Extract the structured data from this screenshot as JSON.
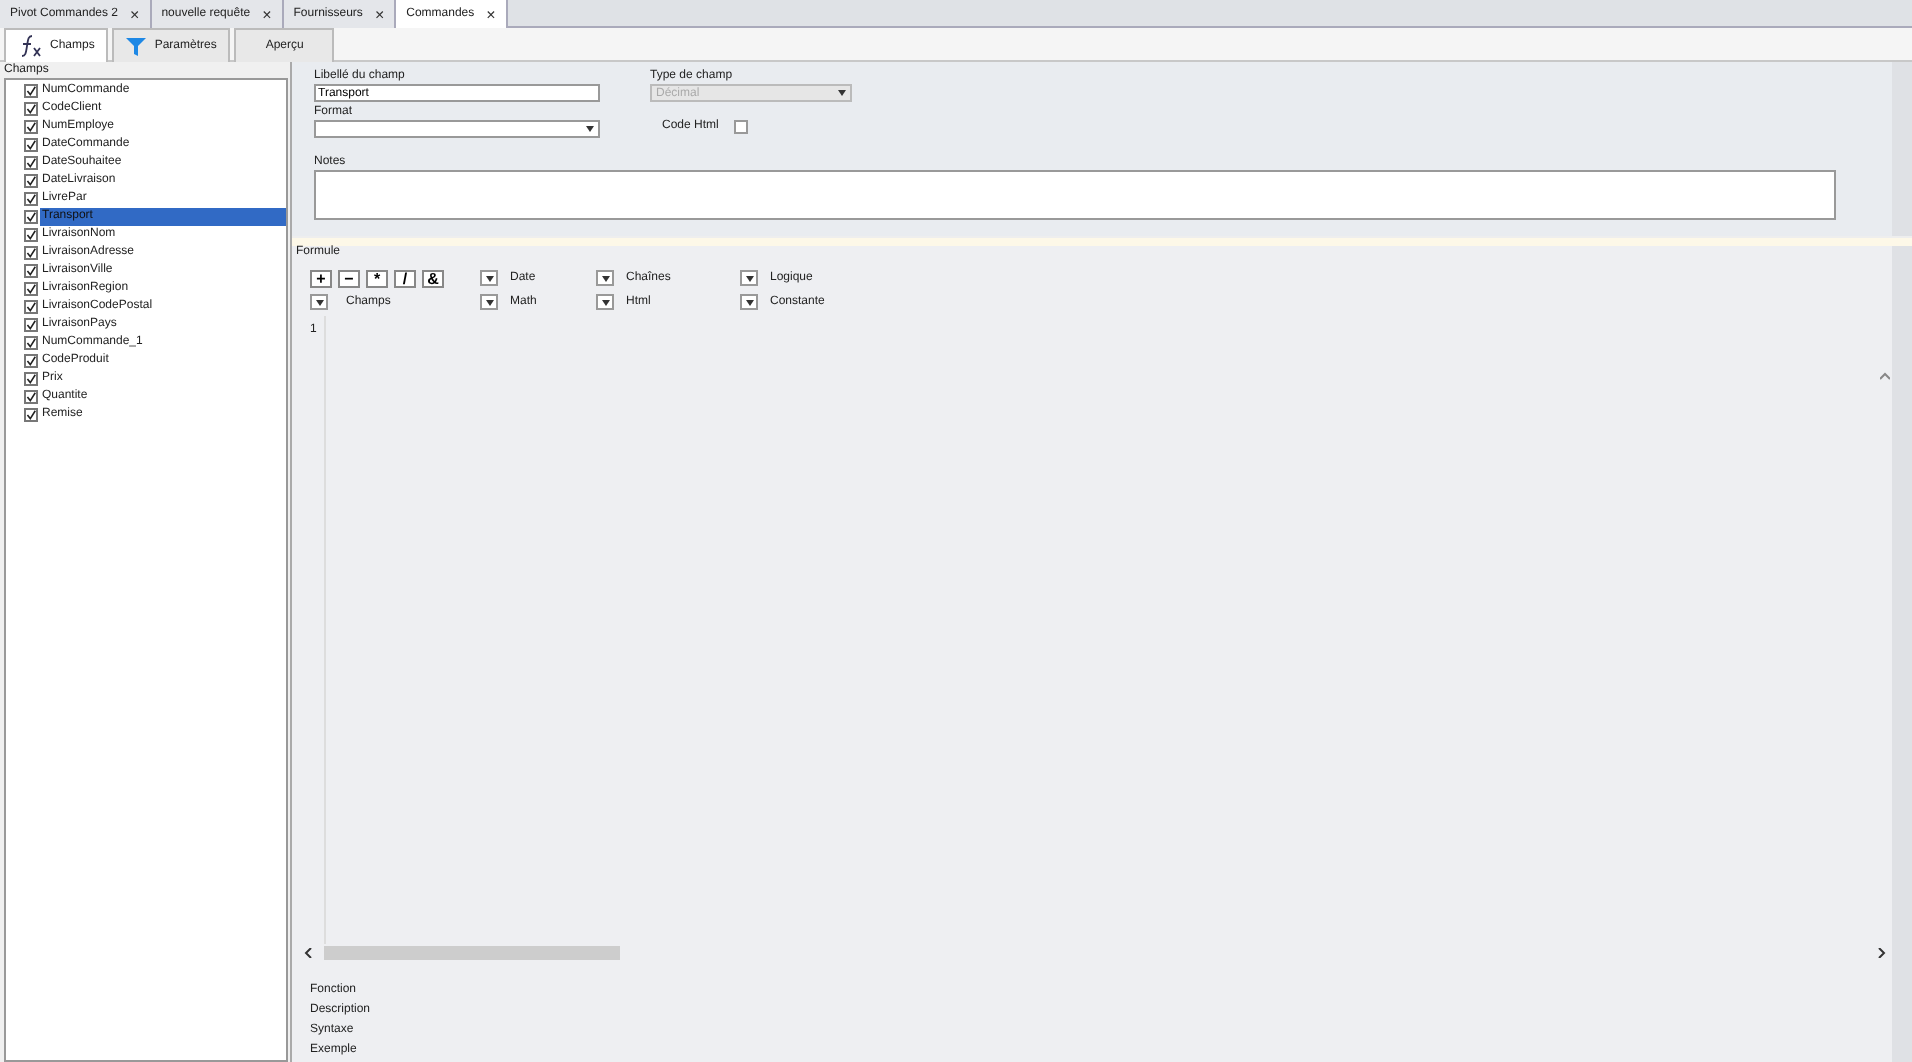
{
  "document_tabs": [
    {
      "label": "Pivot Commandes 2",
      "selected": false,
      "close": "×"
    },
    {
      "label": "nouvelle requête",
      "selected": false,
      "close": "×"
    },
    {
      "label": "Fournisseurs",
      "selected": false,
      "close": "×"
    },
    {
      "label": "Commandes",
      "selected": true,
      "close": "×"
    }
  ],
  "view_tabs": [
    {
      "label": "Champs",
      "kind": "function",
      "selected": true
    },
    {
      "label": "Paramètres",
      "kind": "filter",
      "selected": false
    },
    {
      "label": "Aperçu",
      "kind": "plain",
      "selected": false
    }
  ],
  "fields_panel": {
    "title": "Champs",
    "items": [
      {
        "label": "NumCommande",
        "checked": true,
        "selected": false
      },
      {
        "label": "CodeClient",
        "checked": true,
        "selected": false
      },
      {
        "label": "NumEmploye",
        "checked": true,
        "selected": false
      },
      {
        "label": "DateCommande",
        "checked": true,
        "selected": false
      },
      {
        "label": "DateSouhaitee",
        "checked": true,
        "selected": false
      },
      {
        "label": "DateLivraison",
        "checked": true,
        "selected": false
      },
      {
        "label": "LivrePar",
        "checked": true,
        "selected": false
      },
      {
        "label": "Transport",
        "checked": true,
        "selected": true
      },
      {
        "label": "LivraisonNom",
        "checked": true,
        "selected": false
      },
      {
        "label": "LivraisonAdresse",
        "checked": true,
        "selected": false
      },
      {
        "label": "LivraisonVille",
        "checked": true,
        "selected": false
      },
      {
        "label": "LivraisonRegion",
        "checked": true,
        "selected": false
      },
      {
        "label": "LivraisonCodePostal",
        "checked": true,
        "selected": false
      },
      {
        "label": "LivraisonPays",
        "checked": true,
        "selected": false
      },
      {
        "label": "NumCommande_1",
        "checked": true,
        "selected": false
      },
      {
        "label": "CodeProduit",
        "checked": true,
        "selected": false
      },
      {
        "label": "Prix",
        "checked": true,
        "selected": false
      },
      {
        "label": "Quantite",
        "checked": true,
        "selected": false
      },
      {
        "label": "Remise",
        "checked": true,
        "selected": false
      }
    ]
  },
  "form": {
    "field_label": {
      "label": "Libellé du champ",
      "value": "Transport"
    },
    "field_type": {
      "label": "Type de champ",
      "value": "Décimal",
      "disabled": true
    },
    "format": {
      "label": "Format"
    },
    "html_code": {
      "label": "Code Html",
      "checked": false
    },
    "notes": {
      "label": "Notes"
    }
  },
  "formula": {
    "title": "Formule",
    "operators": [
      "+",
      "−",
      "*",
      "/",
      "&"
    ],
    "menus": [
      {
        "label": "Champs"
      },
      {
        "label": "Date"
      },
      {
        "label": "Math"
      },
      {
        "label": "Chaînes"
      },
      {
        "label": "Html"
      },
      {
        "label": "Logique"
      },
      {
        "label": "Constante"
      }
    ],
    "line_numbers": [
      "1"
    ]
  },
  "help": [
    "Fonction",
    "Description",
    "Syntaxe",
    "Exemple"
  ]
}
